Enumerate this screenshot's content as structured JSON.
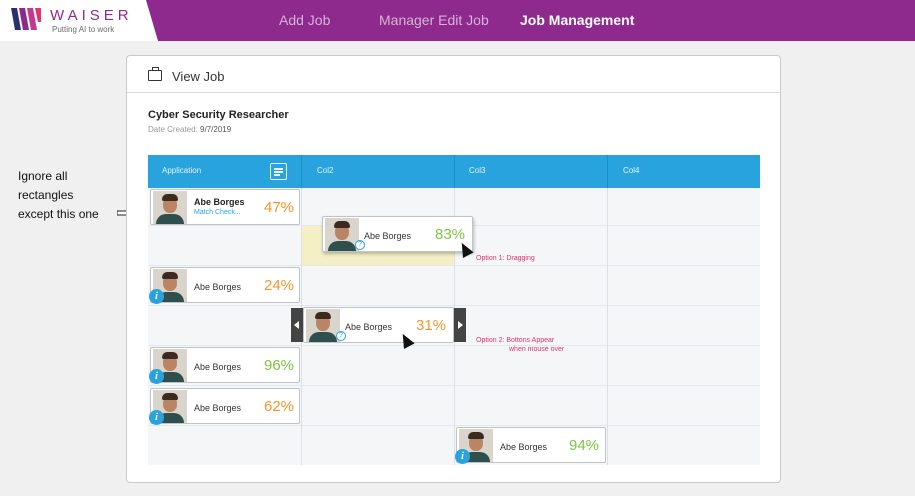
{
  "brand": {
    "name": "WAISER",
    "tagline": "Putting AI to work",
    "accent": "#8e2a8e"
  },
  "nav": [
    {
      "label": "Add Job",
      "active": false
    },
    {
      "label": "Manager Edit Job",
      "active": false
    },
    {
      "label": "Job Management",
      "active": true
    }
  ],
  "card": {
    "title": "View Job",
    "job_title": "Cyber Security Researcher",
    "date_label": "Date Created:",
    "date_value": "9/7/2019"
  },
  "columns": [
    "Application",
    "Col2",
    "Col3",
    "Col4"
  ],
  "candidates": [
    {
      "name": "Abe Borges",
      "sub": "Match Check...",
      "percent": "47%"
    },
    {
      "name": "Abe Borges",
      "percent": "83%"
    },
    {
      "name": "Abe Borges",
      "percent": "24%"
    },
    {
      "name": "Abe Borges",
      "percent": "31%"
    },
    {
      "name": "Abe Borges",
      "percent": "96%"
    },
    {
      "name": "Abe Borges",
      "percent": "62%"
    },
    {
      "name": "Abe Borges",
      "percent": "94%"
    }
  ],
  "annotations": {
    "option1": "Option 1:  Dragging",
    "option2_line1": "Option 2:  Bottons Appear",
    "option2_line2": "when mouse over",
    "side_line1": "Ignore all",
    "side_line2": "rectangles",
    "side_line3": "except this one"
  },
  "icons": {
    "info": "i",
    "question": "?"
  },
  "colors": {
    "header_blue": "#29a3dd",
    "orange": "#f0962a",
    "green": "#7cc441",
    "annotation_pink": "#e0346e"
  }
}
